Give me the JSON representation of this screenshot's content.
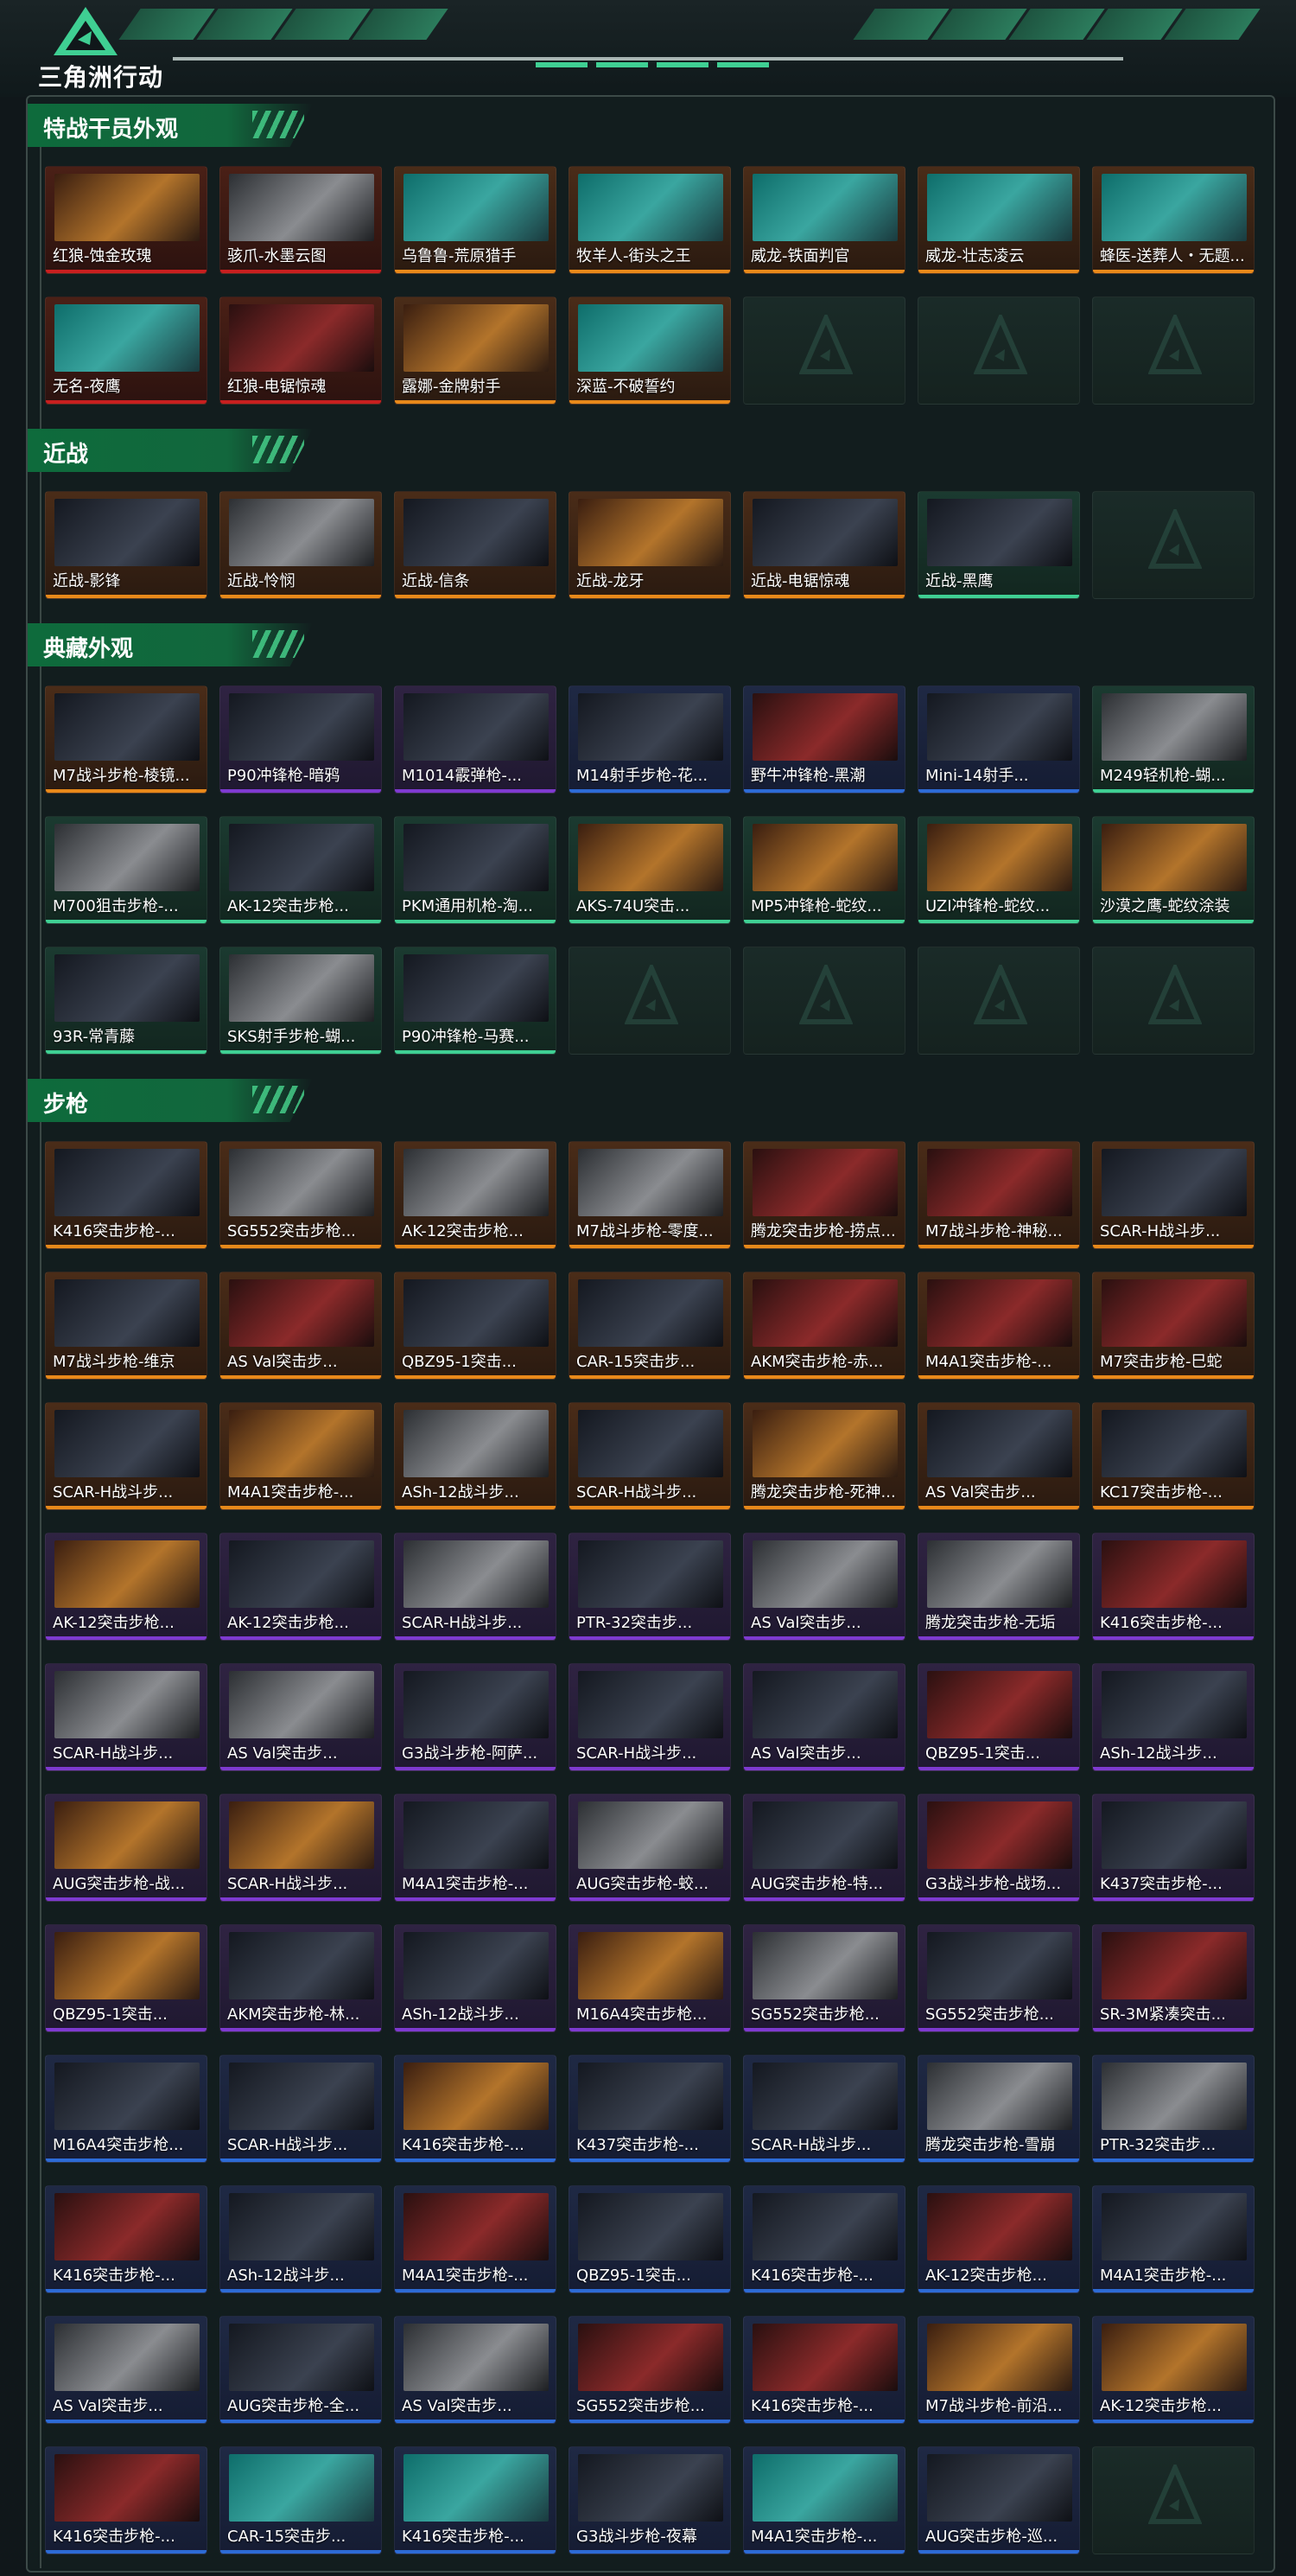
{
  "header": {
    "game_title": "三角洲行动"
  },
  "colors": {
    "accent": "#3fcf93",
    "red": "#c81f1f",
    "orange": "#e8891a",
    "purple": "#7e3ad0",
    "blue": "#2d6bd6",
    "green": "#3fcf93"
  },
  "sections": [
    {
      "title": "特战干员外观",
      "items": [
        {
          "name": "红狼-蚀金玫瑰",
          "rarity": "red",
          "art": "fire"
        },
        {
          "name": "骇爪-水墨云图",
          "rarity": "red",
          "art": "gray"
        },
        {
          "name": "乌鲁鲁-荒原猎手",
          "rarity": "orange",
          "art": "teal"
        },
        {
          "name": "牧羊人-街头之王",
          "rarity": "orange",
          "art": "teal"
        },
        {
          "name": "威龙-铁面判官",
          "rarity": "orange",
          "art": "teal"
        },
        {
          "name": "威龙-壮志凌云",
          "rarity": "orange",
          "art": "teal"
        },
        {
          "name": "蜂医-送葬人・无题...",
          "rarity": "orange",
          "art": "teal"
        },
        {
          "name": "无名-夜鹰",
          "rarity": "red",
          "art": "teal"
        },
        {
          "name": "红狼-电锯惊魂",
          "rarity": "red",
          "art": "red"
        },
        {
          "name": "露娜-金牌射手",
          "rarity": "orange",
          "art": "fire"
        },
        {
          "name": "深蓝-不破誓约",
          "rarity": "orange",
          "art": "teal"
        },
        {
          "empty": true
        },
        {
          "empty": true
        },
        {
          "empty": true
        }
      ]
    },
    {
      "title": "近战",
      "items": [
        {
          "name": "近战-影锋",
          "rarity": "orange",
          "art": "dark"
        },
        {
          "name": "近战-怜悯",
          "rarity": "orange",
          "art": "gray"
        },
        {
          "name": "近战-信条",
          "rarity": "orange",
          "art": "dark"
        },
        {
          "name": "近战-龙牙",
          "rarity": "orange",
          "art": "fire"
        },
        {
          "name": "近战-电锯惊魂",
          "rarity": "orange",
          "art": "dark"
        },
        {
          "name": "近战-黑鹰",
          "rarity": "green",
          "art": "dark"
        },
        {
          "empty": true
        }
      ]
    },
    {
      "title": "典藏外观",
      "items": [
        {
          "name": "M7战斗步枪-棱镜...",
          "rarity": "orange",
          "art": "dark"
        },
        {
          "name": "P90冲锋枪-暗鸦",
          "rarity": "purple",
          "art": "dark"
        },
        {
          "name": "M1014霰弹枪-...",
          "rarity": "purple",
          "art": "dark"
        },
        {
          "name": "M14射手步枪-花...",
          "rarity": "blue",
          "art": "dark"
        },
        {
          "name": "野牛冲锋枪-黑潮",
          "rarity": "blue",
          "art": "red"
        },
        {
          "name": "Mini-14射手...",
          "rarity": "blue",
          "art": "dark"
        },
        {
          "name": "M249轻机枪-蝴...",
          "rarity": "green",
          "art": "gray"
        },
        {
          "name": "M700狙击步枪-...",
          "rarity": "green",
          "art": "gray"
        },
        {
          "name": "AK-12突击步枪...",
          "rarity": "green",
          "art": "dark"
        },
        {
          "name": "PKM通用机枪-淘...",
          "rarity": "green",
          "art": "dark"
        },
        {
          "name": "AKS-74U突击...",
          "rarity": "green",
          "art": "fire"
        },
        {
          "name": "MP5冲锋枪-蛇纹...",
          "rarity": "green",
          "art": "fire"
        },
        {
          "name": "UZI冲锋枪-蛇纹...",
          "rarity": "green",
          "art": "fire"
        },
        {
          "name": "沙漠之鹰-蛇纹涂装",
          "rarity": "green",
          "art": "fire"
        },
        {
          "name": "93R-常青藤",
          "rarity": "green",
          "art": "dark"
        },
        {
          "name": "SKS射手步枪-蝴...",
          "rarity": "green",
          "art": "gray"
        },
        {
          "name": "P90冲锋枪-马赛...",
          "rarity": "green",
          "art": "dark"
        },
        {
          "empty": true
        },
        {
          "empty": true
        },
        {
          "empty": true
        },
        {
          "empty": true
        }
      ]
    },
    {
      "title": "步枪",
      "items": [
        {
          "name": "K416突击步枪-...",
          "rarity": "orange",
          "art": "dark"
        },
        {
          "name": "SG552突击步枪...",
          "rarity": "orange",
          "art": "gray"
        },
        {
          "name": "AK-12突击步枪...",
          "rarity": "orange",
          "art": "gray"
        },
        {
          "name": "M7战斗步枪-零度...",
          "rarity": "orange",
          "art": "gray"
        },
        {
          "name": "腾龙突击步枪-捞点...",
          "rarity": "orange",
          "art": "red"
        },
        {
          "name": "M7战斗步枪-神秘...",
          "rarity": "orange",
          "art": "red"
        },
        {
          "name": "SCAR-H战斗步...",
          "rarity": "orange",
          "art": "dark"
        },
        {
          "name": "M7战斗步枪-维京",
          "rarity": "orange",
          "art": "dark"
        },
        {
          "name": "AS Val突击步...",
          "rarity": "orange",
          "art": "red"
        },
        {
          "name": "QBZ95-1突击...",
          "rarity": "orange",
          "art": "dark"
        },
        {
          "name": "CAR-15突击步...",
          "rarity": "orange",
          "art": "dark"
        },
        {
          "name": "AKM突击步枪-赤...",
          "rarity": "orange",
          "art": "red"
        },
        {
          "name": "M4A1突击步枪-...",
          "rarity": "orange",
          "art": "red"
        },
        {
          "name": "M7突击步枪-巳蛇",
          "rarity": "orange",
          "art": "red"
        },
        {
          "name": "SCAR-H战斗步...",
          "rarity": "orange",
          "art": "dark"
        },
        {
          "name": "M4A1突击步枪-...",
          "rarity": "orange",
          "art": "fire"
        },
        {
          "name": "ASh-12战斗步...",
          "rarity": "orange",
          "art": "gray"
        },
        {
          "name": "SCAR-H战斗步...",
          "rarity": "orange",
          "art": "dark"
        },
        {
          "name": "腾龙突击步枪-死神...",
          "rarity": "orange",
          "art": "fire"
        },
        {
          "name": "AS Val突击步...",
          "rarity": "orange",
          "art": "dark"
        },
        {
          "name": "KC17突击步枪-...",
          "rarity": "orange",
          "art": "dark"
        },
        {
          "name": "AK-12突击步枪...",
          "rarity": "purple",
          "art": "fire"
        },
        {
          "name": "AK-12突击步枪...",
          "rarity": "purple",
          "art": "dark"
        },
        {
          "name": "SCAR-H战斗步...",
          "rarity": "purple",
          "art": "gray"
        },
        {
          "name": "PTR-32突击步...",
          "rarity": "purple",
          "art": "dark"
        },
        {
          "name": "AS Val突击步...",
          "rarity": "purple",
          "art": "gray"
        },
        {
          "name": "腾龙突击步枪-无垢",
          "rarity": "purple",
          "art": "gray"
        },
        {
          "name": "K416突击步枪-...",
          "rarity": "purple",
          "art": "red"
        },
        {
          "name": "SCAR-H战斗步...",
          "rarity": "purple",
          "art": "gray"
        },
        {
          "name": "AS Val突击步...",
          "rarity": "purple",
          "art": "gray"
        },
        {
          "name": "G3战斗步枪-阿萨...",
          "rarity": "purple",
          "art": "dark"
        },
        {
          "name": "SCAR-H战斗步...",
          "rarity": "purple",
          "art": "dark"
        },
        {
          "name": "AS Val突击步...",
          "rarity": "purple",
          "art": "dark"
        },
        {
          "name": "QBZ95-1突击...",
          "rarity": "purple",
          "art": "red"
        },
        {
          "name": "ASh-12战斗步...",
          "rarity": "purple",
          "art": "dark"
        },
        {
          "name": "AUG突击步枪-战...",
          "rarity": "purple",
          "art": "fire"
        },
        {
          "name": "SCAR-H战斗步...",
          "rarity": "purple",
          "art": "fire"
        },
        {
          "name": "M4A1突击步枪-...",
          "rarity": "purple",
          "art": "dark"
        },
        {
          "name": "AUG突击步枪-蛟...",
          "rarity": "purple",
          "art": "gray"
        },
        {
          "name": "AUG突击步枪-特...",
          "rarity": "purple",
          "art": "dark"
        },
        {
          "name": "G3战斗步枪-战场...",
          "rarity": "purple",
          "art": "red"
        },
        {
          "name": "K437突击步枪-...",
          "rarity": "purple",
          "art": "dark"
        },
        {
          "name": "QBZ95-1突击...",
          "rarity": "purple",
          "art": "fire"
        },
        {
          "name": "AKM突击步枪-林...",
          "rarity": "purple",
          "art": "dark"
        },
        {
          "name": "ASh-12战斗步...",
          "rarity": "purple",
          "art": "dark"
        },
        {
          "name": "M16A4突击步枪...",
          "rarity": "purple",
          "art": "fire"
        },
        {
          "name": "SG552突击步枪...",
          "rarity": "purple",
          "art": "gray"
        },
        {
          "name": "SG552突击步枪...",
          "rarity": "purple",
          "art": "dark"
        },
        {
          "name": "SR-3M紧凑突击...",
          "rarity": "purple",
          "art": "red"
        },
        {
          "name": "M16A4突击步枪...",
          "rarity": "blue",
          "art": "dark"
        },
        {
          "name": "SCAR-H战斗步...",
          "rarity": "blue",
          "art": "dark"
        },
        {
          "name": "K416突击步枪-...",
          "rarity": "blue",
          "art": "fire"
        },
        {
          "name": "K437突击步枪-...",
          "rarity": "blue",
          "art": "dark"
        },
        {
          "name": "SCAR-H战斗步...",
          "rarity": "blue",
          "art": "dark"
        },
        {
          "name": "腾龙突击步枪-雪崩",
          "rarity": "blue",
          "art": "gray"
        },
        {
          "name": "PTR-32突击步...",
          "rarity": "blue",
          "art": "gray"
        },
        {
          "name": "K416突击步枪-...",
          "rarity": "blue",
          "art": "red"
        },
        {
          "name": "ASh-12战斗步...",
          "rarity": "blue",
          "art": "dark"
        },
        {
          "name": "M4A1突击步枪-...",
          "rarity": "blue",
          "art": "red"
        },
        {
          "name": "QBZ95-1突击...",
          "rarity": "blue",
          "art": "dark"
        },
        {
          "name": "K416突击步枪-...",
          "rarity": "blue",
          "art": "dark"
        },
        {
          "name": "AK-12突击步枪...",
          "rarity": "blue",
          "art": "red"
        },
        {
          "name": "M4A1突击步枪-...",
          "rarity": "blue",
          "art": "dark"
        },
        {
          "name": "AS Val突击步...",
          "rarity": "blue",
          "art": "gray"
        },
        {
          "name": "AUG突击步枪-全...",
          "rarity": "blue",
          "art": "dark"
        },
        {
          "name": "AS Val突击步...",
          "rarity": "blue",
          "art": "gray"
        },
        {
          "name": "SG552突击步枪...",
          "rarity": "blue",
          "art": "red"
        },
        {
          "name": "K416突击步枪-...",
          "rarity": "blue",
          "art": "red"
        },
        {
          "name": "M7战斗步枪-前沿...",
          "rarity": "blue",
          "art": "fire"
        },
        {
          "name": "AK-12突击步枪...",
          "rarity": "blue",
          "art": "fire"
        },
        {
          "name": "K416突击步枪-...",
          "rarity": "blue",
          "art": "red"
        },
        {
          "name": "CAR-15突击步...",
          "rarity": "blue",
          "art": "teal"
        },
        {
          "name": "K416突击步枪-...",
          "rarity": "blue",
          "art": "teal"
        },
        {
          "name": "G3战斗步枪-夜幕",
          "rarity": "blue",
          "art": "dark"
        },
        {
          "name": "M4A1突击步枪-...",
          "rarity": "blue",
          "art": "teal"
        },
        {
          "name": "AUG突击步枪-巡...",
          "rarity": "blue",
          "art": "dark"
        },
        {
          "empty": true
        }
      ]
    }
  ]
}
